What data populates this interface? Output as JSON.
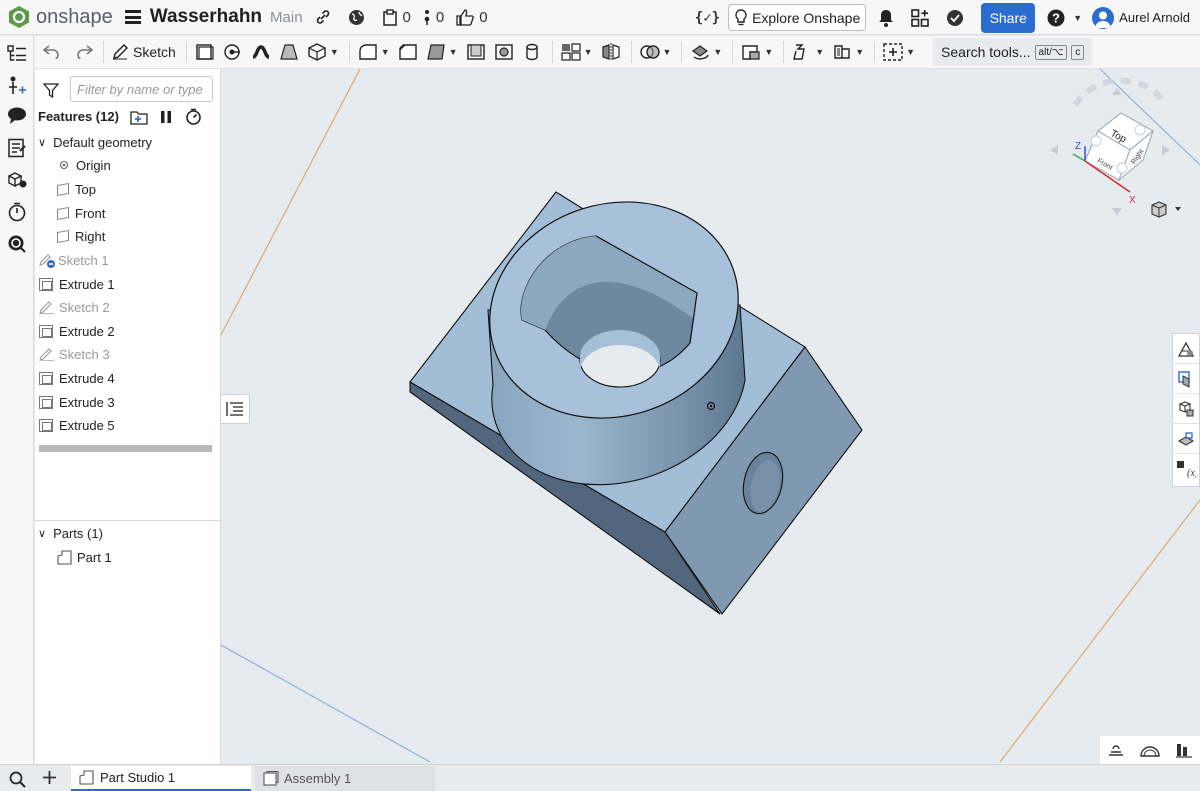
{
  "app": {
    "brand": "onshape",
    "accent": "#2b6cd1"
  },
  "document": {
    "title": "Wasserhahn",
    "branch": "Main",
    "versions_count": "0",
    "branches_count": "0",
    "likes_count": "0"
  },
  "header": {
    "explore_label": "Explore Onshape",
    "share_label": "Share",
    "user_name": "Aurel Arnold"
  },
  "toolbar": {
    "sketch_label": "Sketch",
    "search_label": "Search tools...",
    "shortcut_1": "alt/⌥",
    "shortcut_2": "c"
  },
  "features": {
    "filter_placeholder": "Filter by name or type",
    "heading": "Features (12)",
    "default_geometry_label": "Default geometry",
    "origin": "Origin",
    "planes": [
      "Top",
      "Front",
      "Right"
    ],
    "items": [
      {
        "label": "Sketch 1",
        "type": "sketch",
        "state": "suppressed"
      },
      {
        "label": "Extrude 1",
        "type": "extrude",
        "state": "normal"
      },
      {
        "label": "Sketch 2",
        "type": "sketch",
        "state": "suppressed"
      },
      {
        "label": "Extrude 2",
        "type": "extrude",
        "state": "normal"
      },
      {
        "label": "Sketch 3",
        "type": "sketch",
        "state": "suppressed"
      },
      {
        "label": "Extrude 4",
        "type": "extrude",
        "state": "normal"
      },
      {
        "label": "Extrude 3",
        "type": "extrude",
        "state": "normal"
      },
      {
        "label": "Extrude 5",
        "type": "extrude",
        "state": "normal"
      }
    ]
  },
  "parts": {
    "heading": "Parts (1)",
    "items": [
      "Part 1"
    ]
  },
  "view_cube": {
    "face_top": "Top",
    "face_front": "Front",
    "face_right": "Right",
    "axis_x": "X",
    "axis_z": "Z"
  },
  "tabs": [
    {
      "label": "Part Studio 1",
      "active": true
    },
    {
      "label": "Assembly 1",
      "active": false
    }
  ]
}
